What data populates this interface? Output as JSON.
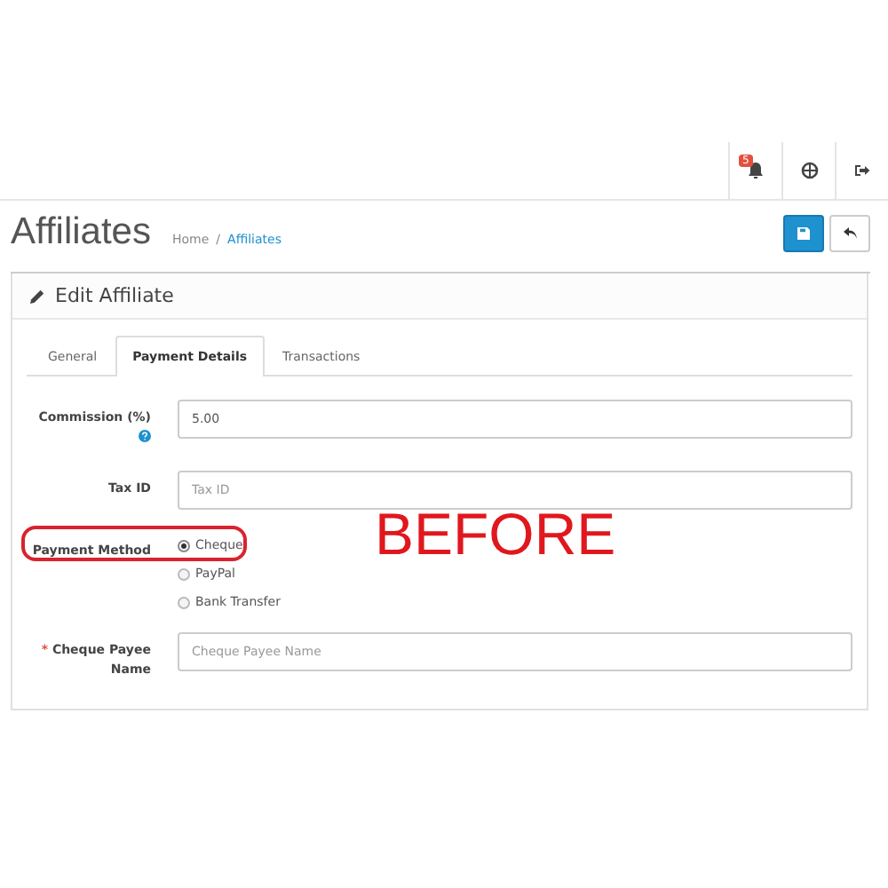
{
  "topbar": {
    "notification_badge": "5"
  },
  "page": {
    "title": "Affiliates",
    "breadcrumb_separator": "/",
    "breadcrumbs": [
      {
        "label": "Home",
        "selected": false
      },
      {
        "label": "Affiliates",
        "selected": true
      }
    ]
  },
  "panel": {
    "title": "Edit Affiliate",
    "tabs": [
      {
        "label": "General",
        "selected": false
      },
      {
        "label": "Payment Details",
        "selected": true
      },
      {
        "label": "Transactions",
        "selected": false
      }
    ],
    "fields": [
      {
        "kind": "text",
        "label": "Commission (%)",
        "help": true,
        "required": false,
        "highlighted": false,
        "value": "5.00"
      },
      {
        "kind": "text",
        "label": "Tax ID",
        "help": false,
        "required": false,
        "highlighted": false,
        "placeholder": "Tax ID"
      },
      {
        "kind": "radio",
        "label": "Payment Method",
        "help": false,
        "required": false,
        "highlighted": true,
        "options": [
          {
            "label": "Cheque",
            "selected": true
          },
          {
            "label": "PayPal",
            "selected": false
          },
          {
            "label": "Bank Transfer",
            "selected": false
          }
        ]
      },
      {
        "kind": "text",
        "label": "Cheque Payee Name",
        "help": false,
        "required": true,
        "required_mark": "*",
        "highlighted": false,
        "placeholder": "Cheque Payee Name"
      }
    ]
  },
  "annotation": {
    "text": "BEFORE"
  }
}
